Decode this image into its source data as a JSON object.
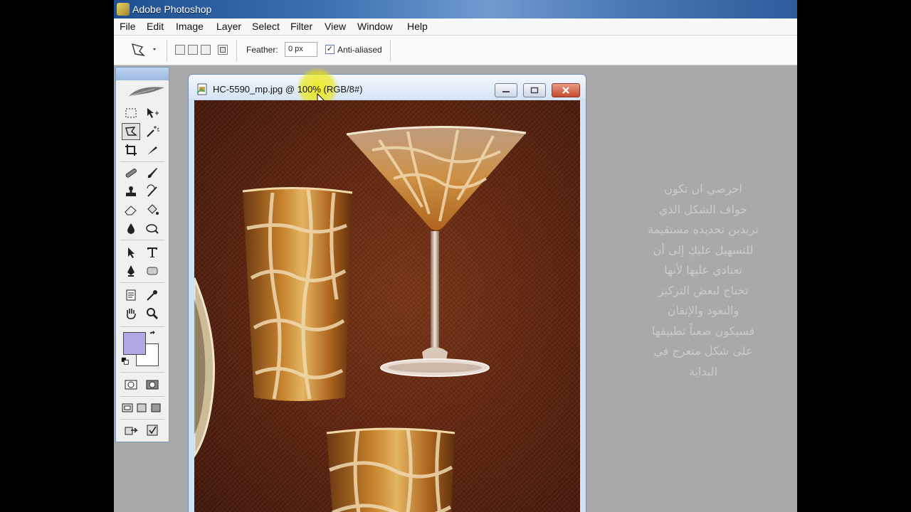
{
  "window": {
    "title": "Adobe Photoshop"
  },
  "menu": [
    "File",
    "Edit",
    "Image",
    "Layer",
    "Select",
    "Filter",
    "View",
    "Window",
    "Help"
  ],
  "options": {
    "feather_label": "Feather:",
    "feather_value": "0 px",
    "antialiased_label": "Anti-aliased",
    "antialiased_checked": true
  },
  "document": {
    "title": "HC-5590_mp.jpg @ 100% (RGB/8#)"
  },
  "colors": {
    "foreground": "#b3a8e6",
    "background": "#ffffff",
    "title_bar": "#3a6fb0",
    "workspace": "#a9a9a9"
  },
  "tools": [
    "marquee-tool",
    "move-tool",
    "polygonal-lasso-tool",
    "magic-wand-tool",
    "crop-tool",
    "slice-tool",
    "healing-brush-tool",
    "brush-tool",
    "clone-stamp-tool",
    "history-brush-tool",
    "eraser-tool",
    "paint-bucket-tool",
    "blur-tool",
    "dodge-tool",
    "path-selection-tool",
    "type-tool",
    "pen-tool",
    "shape-tool",
    "notes-tool",
    "eyedropper-tool",
    "hand-tool",
    "zoom-tool"
  ],
  "note_lines": [
    "احرصي ان تكون",
    "حواف الشكل الذي",
    "تريدين تحديده مستقيمة",
    "للتسهيل عليكِ إلى أن",
    "تعتادي عليها لأنها",
    "تحتاج لبعض التركيز",
    "والتعود والإتقان",
    "فسيكون صعباً تطبيقها",
    "على شكل متعرج في",
    "البداية"
  ]
}
